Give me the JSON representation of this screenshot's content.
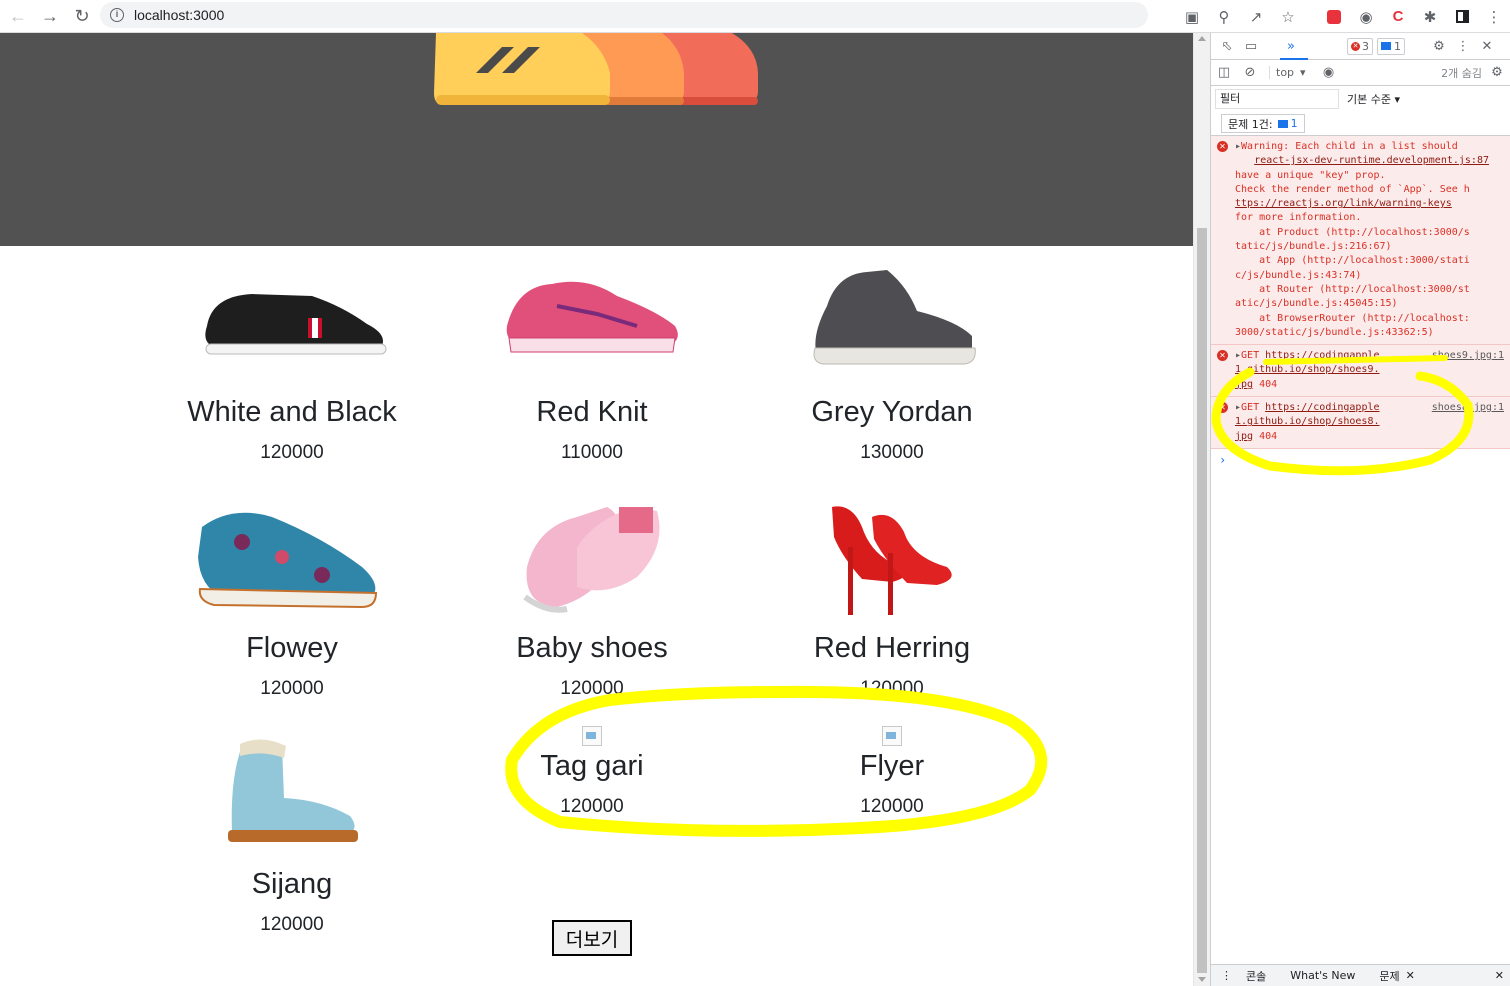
{
  "browser": {
    "url": "localhost:3000",
    "back_icon": "arrow-left-icon",
    "forward_icon": "arrow-right-icon",
    "reload_icon": "reload-icon"
  },
  "products": [
    {
      "title": "White and Black",
      "price": "120000",
      "image": "sneaker-black"
    },
    {
      "title": "Red Knit",
      "price": "110000",
      "image": "running-shoe-pink"
    },
    {
      "title": "Grey Yordan",
      "price": "130000",
      "image": "high-top-grey"
    },
    {
      "title": "Flowey",
      "price": "120000",
      "image": "floral-oxford"
    },
    {
      "title": "Baby shoes",
      "price": "120000",
      "image": "pink-slip-on"
    },
    {
      "title": "Red Herring",
      "price": "120000",
      "image": "red-heels"
    },
    {
      "title": "Sijang",
      "price": "120000",
      "image": "light-blue-boot"
    },
    {
      "title": "Tag gari",
      "price": "120000",
      "image": "broken-image"
    },
    {
      "title": "Flyer",
      "price": "120000",
      "image": "broken-image"
    }
  ],
  "more_button": "더보기",
  "devtools": {
    "error_count": "3",
    "issue_count": "1",
    "context": "top",
    "hidden_count": "2개 숨김",
    "filter_placeholder": "필터",
    "level": "기본 수준",
    "issues_label": "문제 1건:",
    "issues_badge": "1",
    "warning_lines": [
      "Warning: Each child in a list should",
      "have a unique \"key\" prop.",
      "",
      "Check the render method of `App`. See h",
      "ttps://reactjs.org/link/warning-keys",
      "for more information.",
      "    at Product (http://localhost:3000/s",
      "tatic/js/bundle.js:216:67)",
      "    at App (http://localhost:3000/stati",
      "c/js/bundle.js:43:74)",
      "    at Router (http://localhost:3000/st",
      "atic/js/bundle.js:45045:15)",
      "    at BrowserRouter (http://localhost:",
      "3000/static/js/bundle.js:43362:5)"
    ],
    "warning_source": "react-jsx-dev-runtime.development.js:87",
    "errors": [
      {
        "method": "GET",
        "url": "https://codingapple1.github.io/shop/shoes9.jpg",
        "status": "404",
        "source": "shoes9.jpg:1"
      },
      {
        "method": "GET",
        "url": "https://codingapple1.github.io/shop/shoes8.jpg",
        "status": "404",
        "source": "shoes8.jpg:1"
      }
    ],
    "drawer_tabs": [
      "콘솔",
      "What's New",
      "문제"
    ]
  },
  "colors": {
    "hero_bg": "#525252",
    "highlight": "#ffff00",
    "error_red": "#d93025",
    "link_blue": "#1a73e8"
  }
}
